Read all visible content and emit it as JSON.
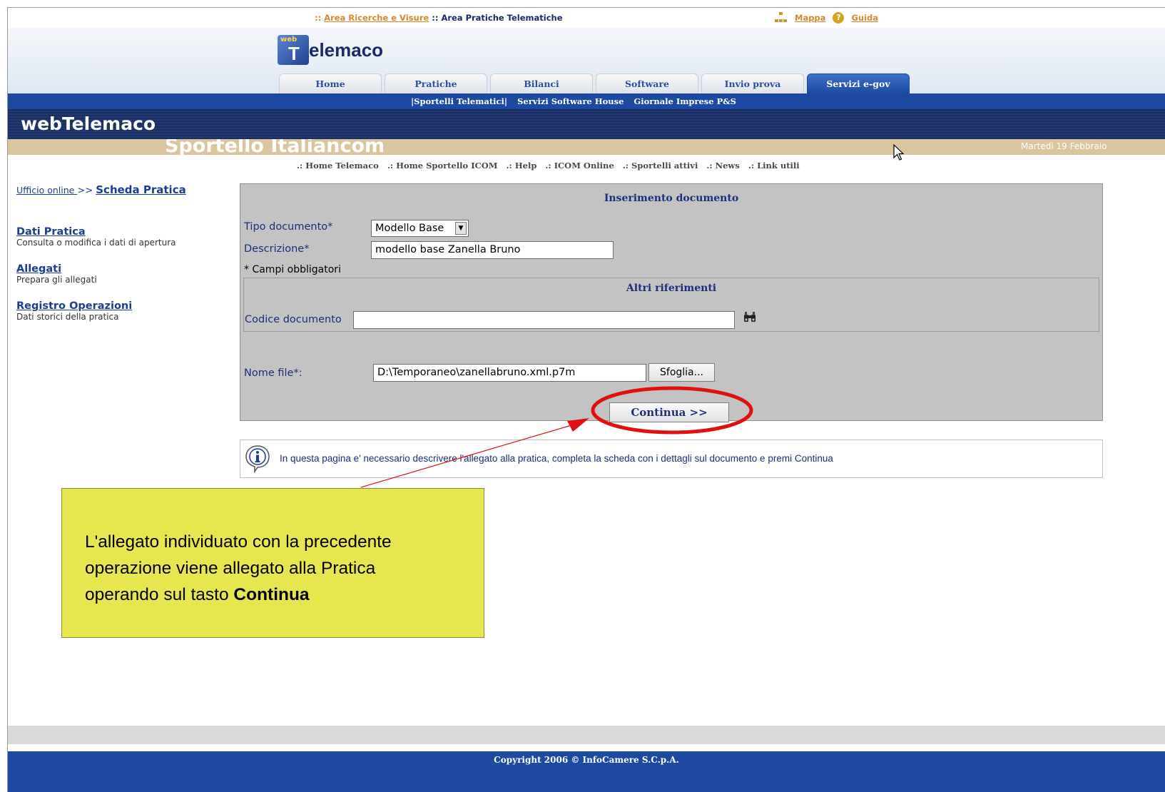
{
  "topbar": {
    "link_ricerche": "Area Ricerche e Visure",
    "sep1": "::",
    "sep2": "::",
    "current": "Area Pratiche Telematiche",
    "mappa": "Mappa",
    "guida": "Guida"
  },
  "logo": {
    "web": "web",
    "t": "T",
    "name": "elemaco"
  },
  "tabs": [
    "Home",
    "Pratiche",
    "Bilanci",
    "Software",
    "Invio prova",
    "Servizi e-gov"
  ],
  "subnav": [
    "|Sportelli Telematici|",
    "Servizi Software House",
    "Giornale Imprese P&S"
  ],
  "title": "webTelemaco",
  "sportello": {
    "name": "Sportello Italiancom",
    "date": "Martedì 19 Febbraio"
  },
  "sitenav": [
    ".: Home Telemaco",
    ".: Home Sportello ICOM",
    ".: Help",
    ".: ICOM Online",
    ".: Sportelli attivi",
    ".: News",
    ".: Link utili"
  ],
  "sidebar": {
    "crumb_link": "Ufficio online ",
    "crumb_sep": ">>",
    "crumb_current": "Scheda Pratica",
    "items": [
      {
        "title": "Dati Pratica",
        "sub": "Consulta o modifica i dati di apertura"
      },
      {
        "title": "Allegati",
        "sub": "Prepara gli allegati"
      },
      {
        "title": "Registro Operazioni",
        "sub": "Dati storici della pratica"
      }
    ]
  },
  "form": {
    "heading": "Inserimento documento",
    "tipo_label": "Tipo documento*",
    "tipo_value": "Modello Base",
    "descr_label": "Descrizione*",
    "descr_value": "modello base Zanella Bruno",
    "required_note": "* Campi obbligatori",
    "altri_heading": "Altri riferimenti",
    "codice_label": "Codice documento",
    "codice_value": "",
    "file_label": "Nome file*:",
    "file_value": "D:\\Temporaneo\\zanellabruno.xml.p7m",
    "browse_label": "Sfoglia...",
    "continue_label": "Continua >>"
  },
  "info": {
    "text": "In questa pagina e' necessario descrivere l'allegato alla pratica, completa la scheda con i dettagli sul documento e premi Continua"
  },
  "callout": {
    "line1": "L'allegato individuato con la precedente",
    "line2": "operazione viene allegato alla Pratica",
    "line3_prefix": "operando sul tasto ",
    "line3_bold": "Continua"
  },
  "footer": {
    "text": "Copyright 2006 © InfoCamere S.C.p.A."
  },
  "colors": {
    "nav_blue": "#1d4aa0",
    "title_navy": "#1b2e63",
    "callout_yellow": "#e6e64f",
    "highlight_red": "#e01010"
  }
}
